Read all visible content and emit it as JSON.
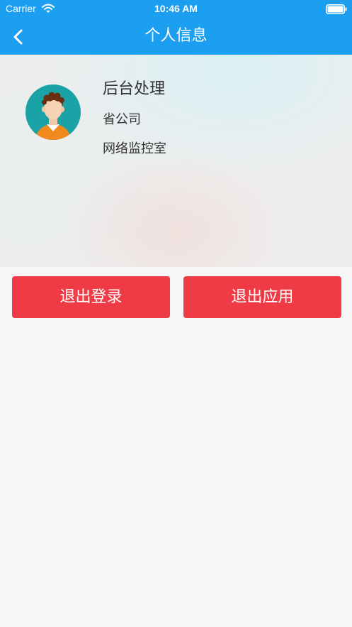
{
  "status_bar": {
    "carrier": "Carrier",
    "time": "10:46 AM"
  },
  "nav": {
    "title": "个人信息",
    "back_icon": "chevron-left-icon"
  },
  "profile": {
    "avatar_icon": "user-avatar-icon",
    "name": "后台处理",
    "organization": "省公司",
    "department": "网络监控室"
  },
  "actions": {
    "logout_label": "退出登录",
    "exit_app_label": "退出应用"
  },
  "colors": {
    "nav_background": "#1c9ff0",
    "button_background": "#ef3b46",
    "page_background": "#f6f6f7"
  }
}
